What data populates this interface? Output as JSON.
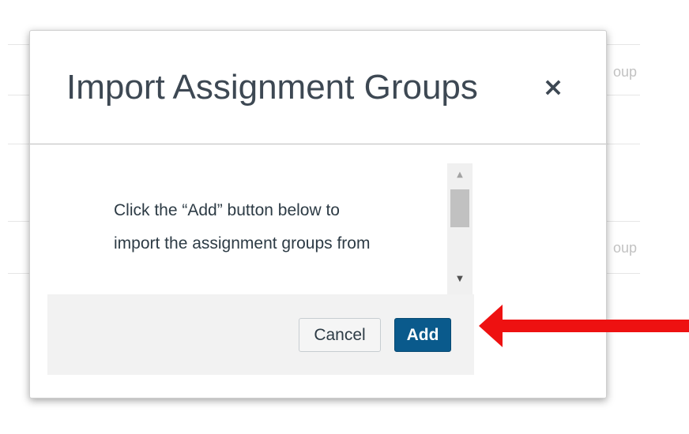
{
  "background": {
    "row_fragment_1": "oup",
    "row_fragment_2": "oup"
  },
  "modal": {
    "title": "Import Assignment Groups",
    "close_glyph": "×",
    "body_text": "Click the “Add” button below to import the assignment groups from",
    "cancel_label": "Cancel",
    "add_label": "Add"
  },
  "scrollbar": {
    "up_glyph": "▲",
    "down_glyph": "▼"
  },
  "annotation": {
    "arrow_color": "#ee1111"
  },
  "colors": {
    "primary_button": "#0a5a8c",
    "title_text": "#3d4853"
  },
  "icons": {
    "close": "close-icon",
    "scroll_up": "scroll-up-arrow-icon",
    "scroll_down": "scroll-down-arrow-icon",
    "annotation": "red-arrow-icon"
  }
}
